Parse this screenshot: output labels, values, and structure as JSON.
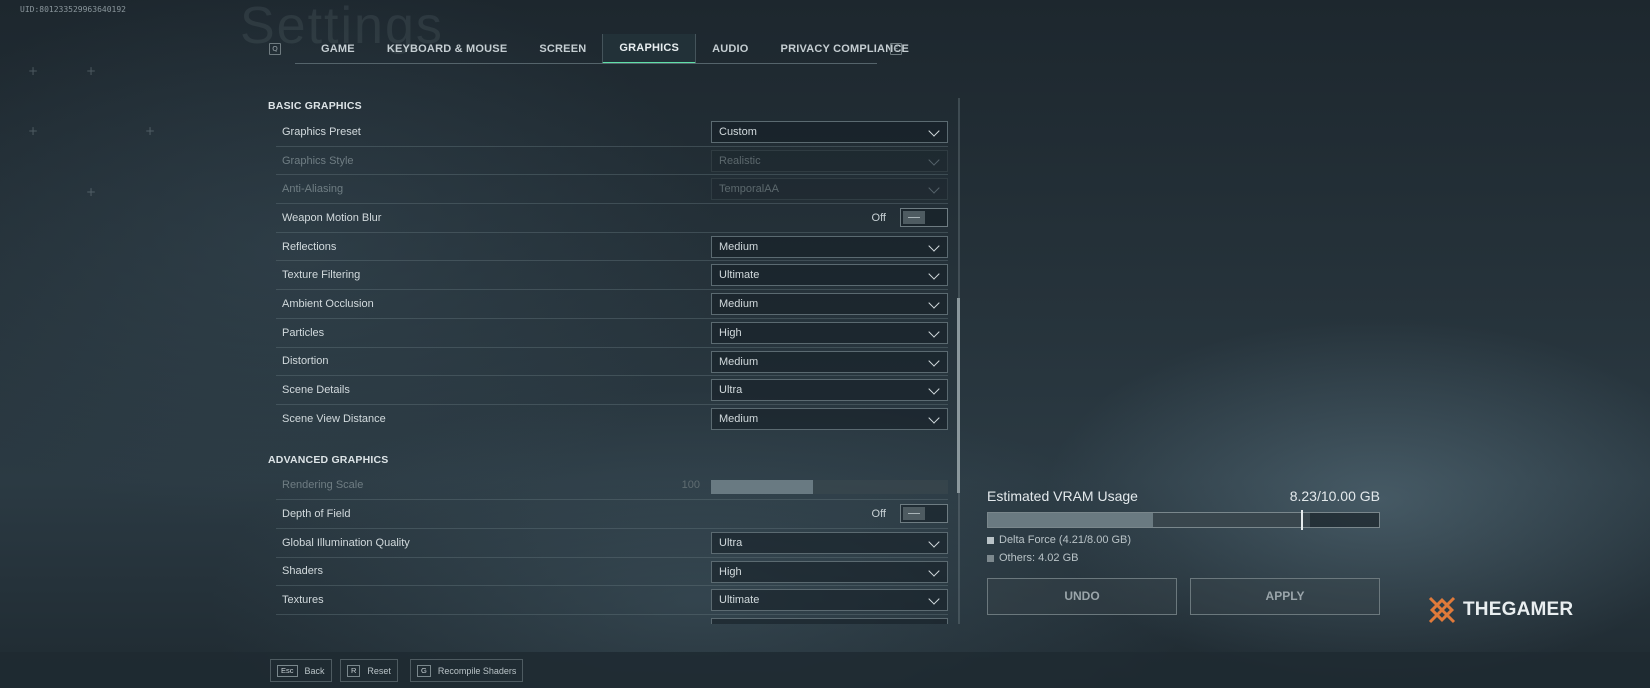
{
  "uid": "UID:801233529963640192",
  "page_title": "Settings",
  "tabs": {
    "prev_key": "Q",
    "next_key": "E",
    "items": [
      {
        "label": "GAME"
      },
      {
        "label": "KEYBOARD & MOUSE"
      },
      {
        "label": "SCREEN"
      },
      {
        "label": "GRAPHICS"
      },
      {
        "label": "AUDIO"
      },
      {
        "label": "PRIVACY COMPLIANCE"
      }
    ],
    "active": "GRAPHICS"
  },
  "basic": {
    "title": "BASIC GRAPHICS",
    "graphics_preset": {
      "label": "Graphics Preset",
      "value": "Custom"
    },
    "graphics_style": {
      "label": "Graphics Style",
      "value": "Realistic"
    },
    "anti_aliasing": {
      "label": "Anti-Aliasing",
      "value": "TemporalAA"
    },
    "weapon_motion_blur": {
      "label": "Weapon Motion Blur",
      "value": "Off"
    },
    "reflections": {
      "label": "Reflections",
      "value": "Medium"
    },
    "texture_filtering": {
      "label": "Texture Filtering",
      "value": "Ultimate"
    },
    "ambient_occlusion": {
      "label": "Ambient Occlusion",
      "value": "Medium"
    },
    "particles": {
      "label": "Particles",
      "value": "High"
    },
    "distortion": {
      "label": "Distortion",
      "value": "Medium"
    },
    "scene_details": {
      "label": "Scene Details",
      "value": "Ultra"
    },
    "scene_view_distance": {
      "label": "Scene View Distance",
      "value": "Medium"
    }
  },
  "advanced": {
    "title": "ADVANCED GRAPHICS",
    "rendering_scale": {
      "label": "Rendering Scale",
      "value": "100",
      "fill_fraction": 0.43
    },
    "depth_of_field": {
      "label": "Depth of Field",
      "value": "Off"
    },
    "global_illumination": {
      "label": "Global Illumination Quality",
      "value": "Ultra"
    },
    "shaders": {
      "label": "Shaders",
      "value": "High"
    },
    "textures": {
      "label": "Textures",
      "value": "Ultimate"
    }
  },
  "vram": {
    "title": "Estimated VRAM Usage",
    "total": "8.23/10.00 GB",
    "used_gb": 8.23,
    "capacity_gb": 10.0,
    "delta_force_gb": 4.21,
    "others_gb": 4.02,
    "delta_force_label": "Delta Force (4.21/8.00 GB)",
    "others_label": "Others: 4.02 GB",
    "marker_gb": 8.0,
    "colors": {
      "delta_force": "#6a7a81",
      "others": "#39464d"
    }
  },
  "actions": {
    "undo": "UNDO",
    "apply": "APPLY"
  },
  "watermark": "THEGAMER",
  "footer": [
    {
      "key": "Esc",
      "label": "Back"
    },
    {
      "key": "R",
      "label": "Reset"
    },
    {
      "key": "G",
      "label": "Recompile Shaders"
    }
  ]
}
